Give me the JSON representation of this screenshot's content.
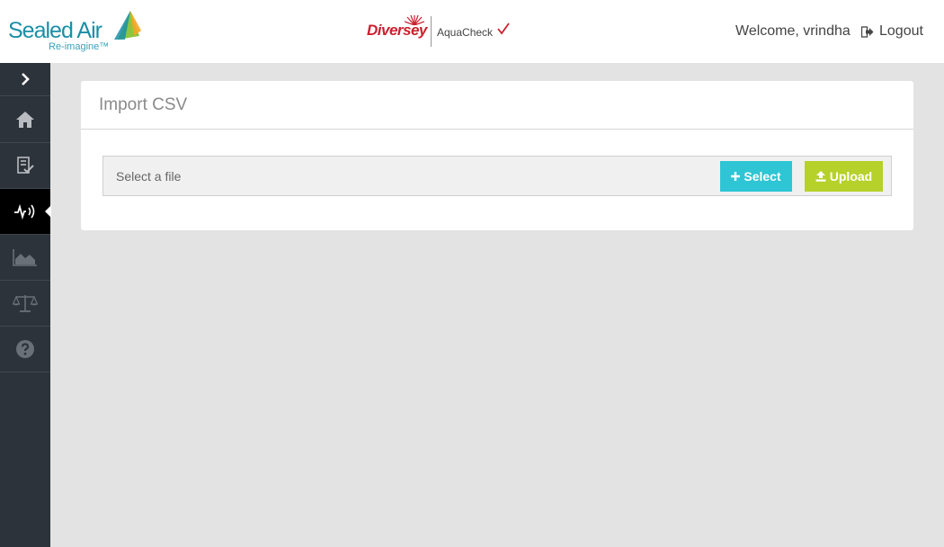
{
  "header": {
    "logo_text": "Sealed Air",
    "logo_tagline": "Re-imagine™",
    "partner_brand": "Diversey",
    "product_name": "AquaCheck",
    "welcome_text": "Welcome, vrindha",
    "logout_label": "Logout"
  },
  "sidebar": {
    "items": [
      {
        "icon": "chevron-right-icon"
      },
      {
        "icon": "home-icon"
      },
      {
        "icon": "checklist-icon"
      },
      {
        "icon": "signal-icon",
        "active": true
      },
      {
        "icon": "area-chart-icon"
      },
      {
        "icon": "balance-scale-icon"
      },
      {
        "icon": "help-icon"
      }
    ]
  },
  "main": {
    "card_title": "Import CSV",
    "file_placeholder": "Select a file",
    "select_label": "Select",
    "upload_label": "Upload"
  },
  "colors": {
    "sidebar_bg": "#2d333a",
    "select_button": "#2ec5d4",
    "upload_button": "#b5d12a",
    "brand_teal": "#1b8fa6",
    "brand_red": "#cc1f2d"
  }
}
